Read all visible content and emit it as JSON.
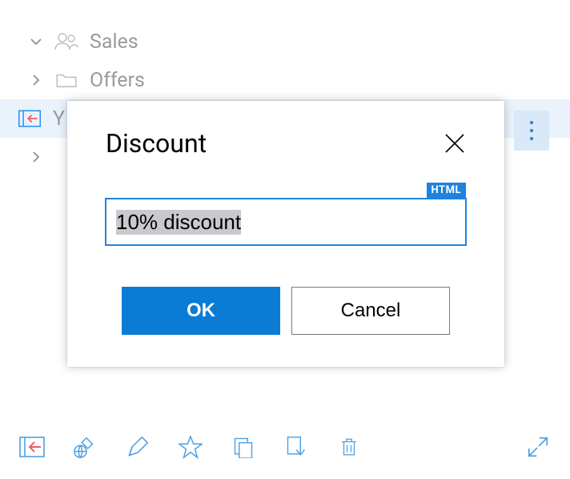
{
  "tree": {
    "items": [
      {
        "label": "Sales",
        "expanded": true,
        "icon": "people-icon"
      },
      {
        "label": "Offers",
        "expanded": false,
        "icon": "folder-icon"
      },
      {
        "label": "Y",
        "selected": true,
        "icon": "folder-in-icon"
      },
      {
        "label": "",
        "expanded": false,
        "icon": "folder-icon"
      }
    ]
  },
  "modal": {
    "title": "Discount",
    "field_tag": "HTML",
    "field_value": "10% discount",
    "ok_label": "OK",
    "cancel_label": "Cancel"
  },
  "colors": {
    "primary": "#0b7cd5",
    "selection_row": "#eaf3fc"
  }
}
